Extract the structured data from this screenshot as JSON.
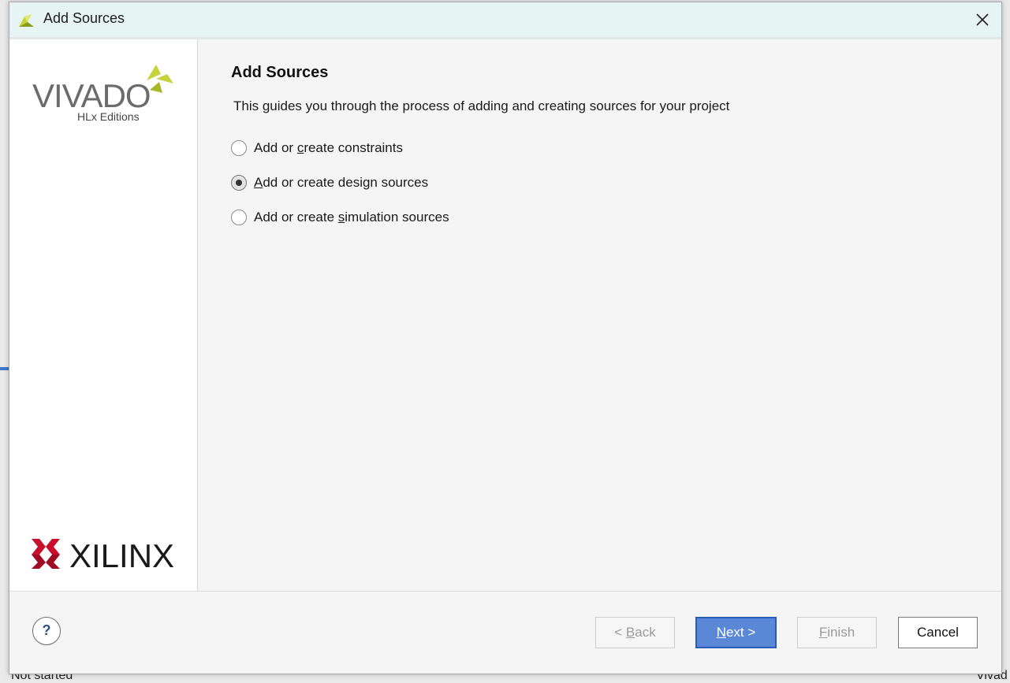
{
  "window": {
    "title": "Add Sources",
    "close_icon": "close-icon"
  },
  "branding": {
    "vivado_logo_text": "VIVADO",
    "vivado_edition_text": "HLx Editions",
    "xilinx_logo_text": "XILINX",
    "colors": {
      "vivado_green": "#c7d33a",
      "xilinx_red": "#c8102e"
    }
  },
  "content": {
    "heading": "Add Sources",
    "description": "This guides you through the process of adding and creating sources for your project",
    "options": [
      {
        "pre": "Add or ",
        "mnemonic": "c",
        "post": "reate constraints",
        "selected": false
      },
      {
        "pre": "",
        "mnemonic": "A",
        "post": "dd or create design sources",
        "selected": true
      },
      {
        "pre": "Add or create ",
        "mnemonic": "s",
        "post": "imulation sources",
        "selected": false
      }
    ]
  },
  "footer": {
    "help_label": "?",
    "back": {
      "pre": "< ",
      "mnemonic": "B",
      "post": "ack",
      "enabled": false
    },
    "next": {
      "pre": "",
      "mnemonic": "N",
      "post": "ext >",
      "enabled": true
    },
    "finish": {
      "pre": "",
      "mnemonic": "F",
      "post": "inish",
      "enabled": false
    },
    "cancel_label": "Cancel"
  },
  "background": {
    "bottom_left_text": "Not started",
    "bottom_right_text": "Vivad"
  }
}
